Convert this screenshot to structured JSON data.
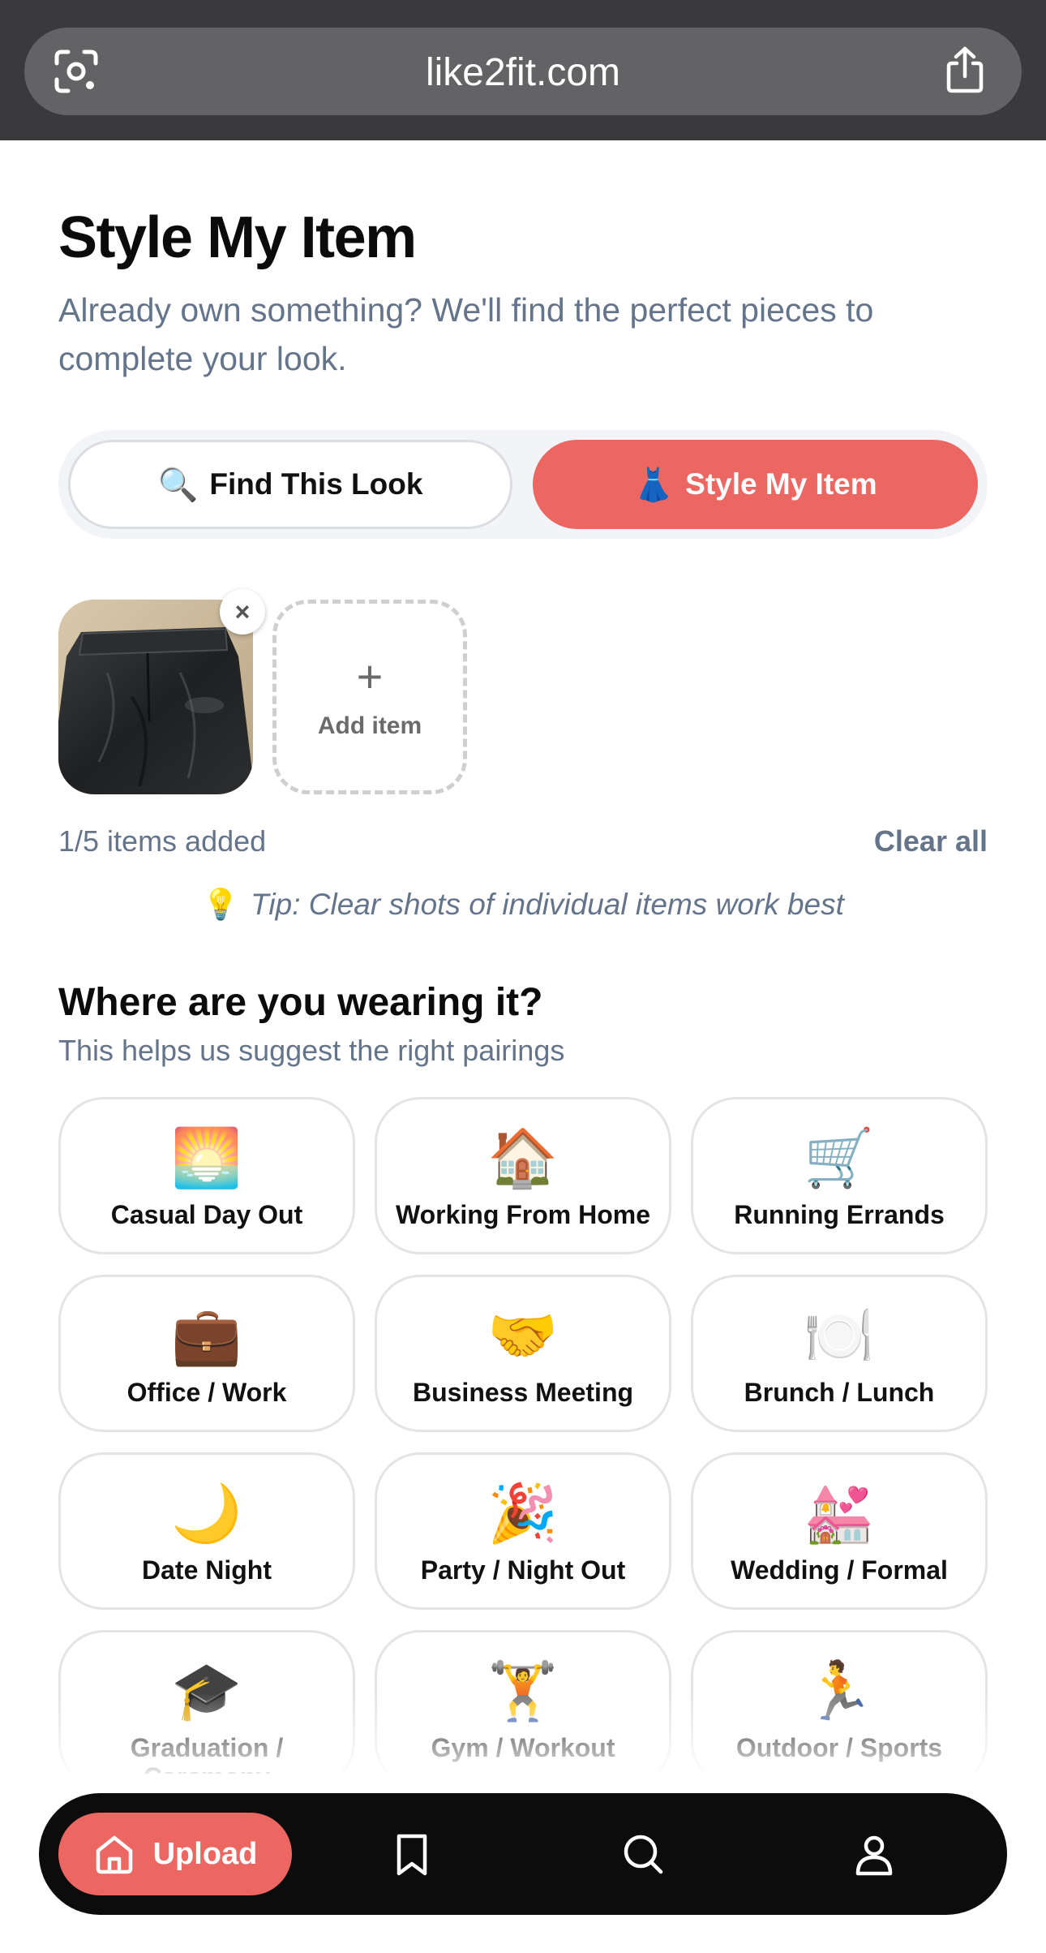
{
  "browser": {
    "url": "like2fit.com"
  },
  "header": {
    "title": "Style My Item",
    "subtitle": "Already own something? We'll find the perfect pieces to complete your look."
  },
  "mode_toggle": {
    "find": {
      "emoji": "🔍",
      "label": "Find This Look"
    },
    "style": {
      "emoji": "👗",
      "label": "Style My Item",
      "active": true
    }
  },
  "items": {
    "add_label": "Add item",
    "remove_symbol": "×",
    "add_symbol": "+",
    "count_text": "1/5 items added",
    "clear_label": "Clear all",
    "tip_emoji": "💡",
    "tip_text": "Tip: Clear shots of individual items work best"
  },
  "occasion": {
    "title": "Where are you wearing it?",
    "subtitle": "This helps us suggest the right pairings",
    "options": [
      {
        "emoji": "🌅",
        "label": "Casual Day Out"
      },
      {
        "emoji": "🏠",
        "label": "Working From Home"
      },
      {
        "emoji": "🛒",
        "label": "Running Errands"
      },
      {
        "emoji": "💼",
        "label": "Office / Work"
      },
      {
        "emoji": "🤝",
        "label": "Business Meeting"
      },
      {
        "emoji": "🍽️",
        "label": "Brunch / Lunch"
      },
      {
        "emoji": "🌙",
        "label": "Date Night"
      },
      {
        "emoji": "🎉",
        "label": "Party / Night Out"
      },
      {
        "emoji": "💒",
        "label": "Wedding / Formal"
      },
      {
        "emoji": "🎓",
        "label": "Graduation / Ceremony"
      },
      {
        "emoji": "🏋️",
        "label": "Gym / Workout"
      },
      {
        "emoji": "🏃",
        "label": "Outdoor / Sports"
      }
    ]
  },
  "bottom_nav": {
    "upload_label": "Upload"
  },
  "colors": {
    "accent": "#ec6762",
    "muted_text": "#64748b",
    "nav_bg": "#0c0c0c"
  }
}
